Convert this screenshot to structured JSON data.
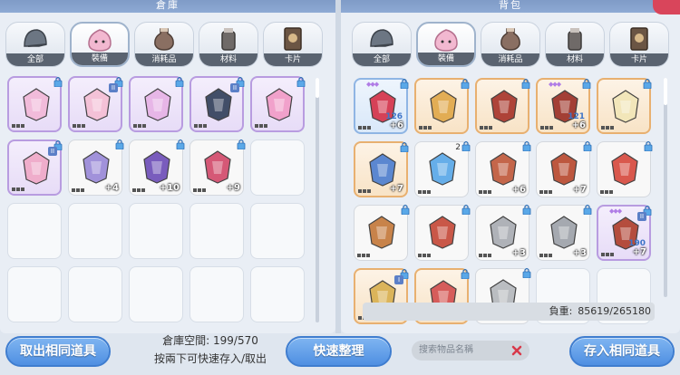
{
  "warehouse": {
    "title": "倉庫",
    "tabs": [
      {
        "label": "全部",
        "icon": "helmet-icon"
      },
      {
        "label": "裝備",
        "icon": "poring-icon"
      },
      {
        "label": "消耗品",
        "icon": "potion-icon"
      },
      {
        "label": "材料",
        "icon": "material-jar-icon"
      },
      {
        "label": "卡片",
        "icon": "card-icon"
      }
    ],
    "active_tab": "裝備",
    "items": [
      {
        "name": "pink-robe-icon",
        "rarity": "purple",
        "color": "#f2b8d8"
      },
      {
        "name": "pink-dress-icon",
        "rarity": "purple",
        "color": "#f5bfd5",
        "tier": "II"
      },
      {
        "name": "pink-fairy-dress-icon",
        "rarity": "purple",
        "color": "#e7b3e6"
      },
      {
        "name": "dark-armor-icon",
        "rarity": "purple",
        "color": "#34425c",
        "tier": "II"
      },
      {
        "name": "pink-boots-icon",
        "rarity": "purple",
        "color": "#f29cc8"
      },
      {
        "name": "pink-boot-icon",
        "rarity": "purple",
        "color": "#f0a9c8",
        "tier": "II"
      },
      {
        "name": "magic-robe-icon",
        "rarity": "white",
        "color": "#9a8ad8",
        "plus": "+4"
      },
      {
        "name": "purple-cape-icon",
        "rarity": "white",
        "color": "#6f4fb8",
        "plus": "+10"
      },
      {
        "name": "red-shield-icon",
        "rarity": "white",
        "color": "#d34b6b",
        "plus": "+9"
      }
    ],
    "storage_label": "倉庫空間:",
    "storage_value": "199/570",
    "hint": "按兩下可快速存入/取出",
    "take_same_label": "取出相同道具",
    "sort_label": "快速整理"
  },
  "backpack": {
    "title": "背包",
    "tabs": [
      {
        "label": "全部",
        "icon": "helmet-icon"
      },
      {
        "label": "裝備",
        "icon": "poring-icon"
      },
      {
        "label": "消耗品",
        "icon": "potion-icon"
      },
      {
        "label": "材料",
        "icon": "material-jar-icon"
      },
      {
        "label": "卡片",
        "icon": "card-icon"
      }
    ],
    "active_tab": "裝備",
    "items": [
      {
        "name": "spiked-shield-icon",
        "rarity": "blue",
        "color": "#d5334a",
        "count": "126",
        "plus": "+6",
        "sparks": "◆◆◆"
      },
      {
        "name": "gold-shield-icon",
        "rarity": "orange",
        "color": "#e0a84a"
      },
      {
        "name": "red-book-icon",
        "rarity": "orange",
        "color": "#a8362c"
      },
      {
        "name": "red-tome-icon",
        "rarity": "orange",
        "color": "#9c3128",
        "count": "121",
        "plus": "+6",
        "sparks": "◆◆◆"
      },
      {
        "name": "white-dress-icon",
        "rarity": "orange",
        "color": "#f2e6b8"
      },
      {
        "name": "blue-shield-icon",
        "rarity": "orange",
        "color": "#4e7fd0",
        "plus": "+7"
      },
      {
        "name": "blue-mirror-icon",
        "rarity": "white",
        "color": "#5aa8e8",
        "qty": "2"
      },
      {
        "name": "rosary-icon",
        "rarity": "white",
        "color": "#c05a3c",
        "plus": "+6"
      },
      {
        "name": "beads-necklace-icon",
        "rarity": "white",
        "color": "#b84a30",
        "plus": "+7"
      },
      {
        "name": "candy-cane-icon",
        "rarity": "white",
        "color": "#d74b3f"
      },
      {
        "name": "slingshot-icon",
        "rarity": "white",
        "color": "#c47a3c"
      },
      {
        "name": "red-slingshot-icon",
        "rarity": "white",
        "color": "#c64a3a"
      },
      {
        "name": "iron-boots-icon",
        "rarity": "white",
        "color": "#a9adb3",
        "plus": "+3"
      },
      {
        "name": "iron-greaves-icon",
        "rarity": "white",
        "color": "#9ea3aa",
        "plus": "+3"
      },
      {
        "name": "golden-book-icon",
        "rarity": "purple",
        "color": "#b0402e",
        "count": "190",
        "plus": "+7",
        "tier": "II",
        "sparks": "◆◆◆"
      },
      {
        "name": "gold-item-icon",
        "rarity": "orange",
        "color": "#d9b050",
        "tier": "I"
      },
      {
        "name": "red-hook-icon",
        "rarity": "orange",
        "color": "#d35050"
      },
      {
        "name": "steel-boots-icon",
        "rarity": "white",
        "color": "#b5b8bd"
      },
      {
        "name": "empty-slot",
        "rarity": "white",
        "color": ""
      }
    ],
    "weight_label": "負重:",
    "weight_value": "85619/265180",
    "search_placeholder": "搜索物品名稱",
    "store_same_label": "存入相同道具"
  }
}
